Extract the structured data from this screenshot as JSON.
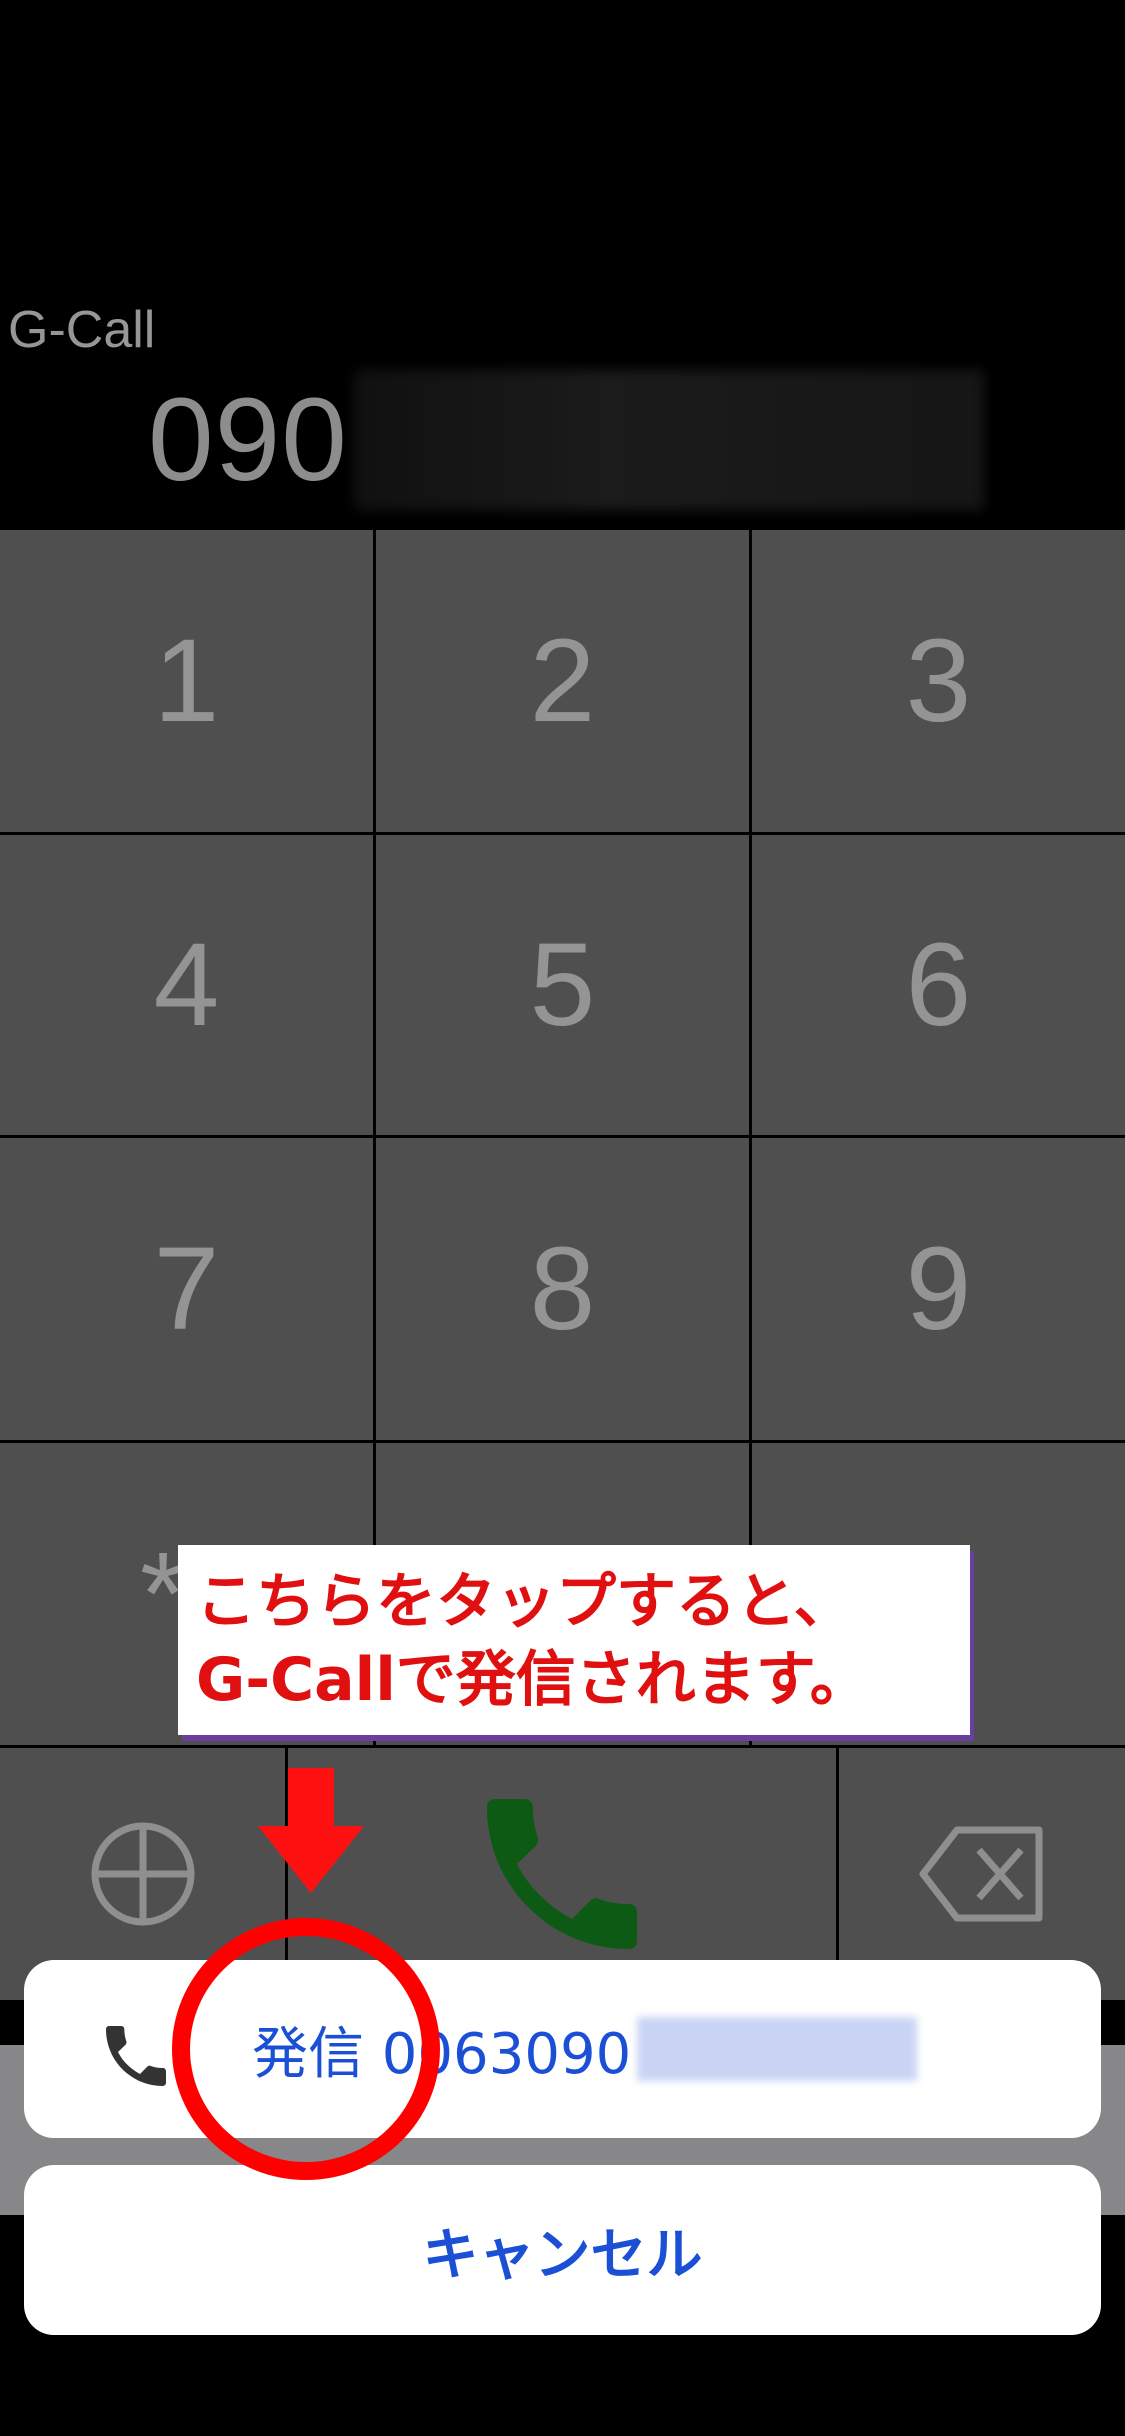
{
  "header": {
    "brand": "G-Call",
    "number_visible": "090"
  },
  "keypad": {
    "keys": [
      "1",
      "2",
      "3",
      "4",
      "5",
      "6",
      "7",
      "8",
      "9"
    ],
    "partial_key": "*"
  },
  "annotation": {
    "text": "こちらをタップすると、\nG-Callで発信されます。"
  },
  "sheet": {
    "call_label": "発信 0063090",
    "cancel_label": "キャンセル"
  },
  "colors": {
    "accent_blue": "#1a4fd6",
    "call_green": "#138a1e",
    "annotation_red": "#e01010"
  },
  "icons": {
    "add": "add-circle-icon",
    "call": "phone-icon",
    "backspace": "backspace-icon"
  }
}
